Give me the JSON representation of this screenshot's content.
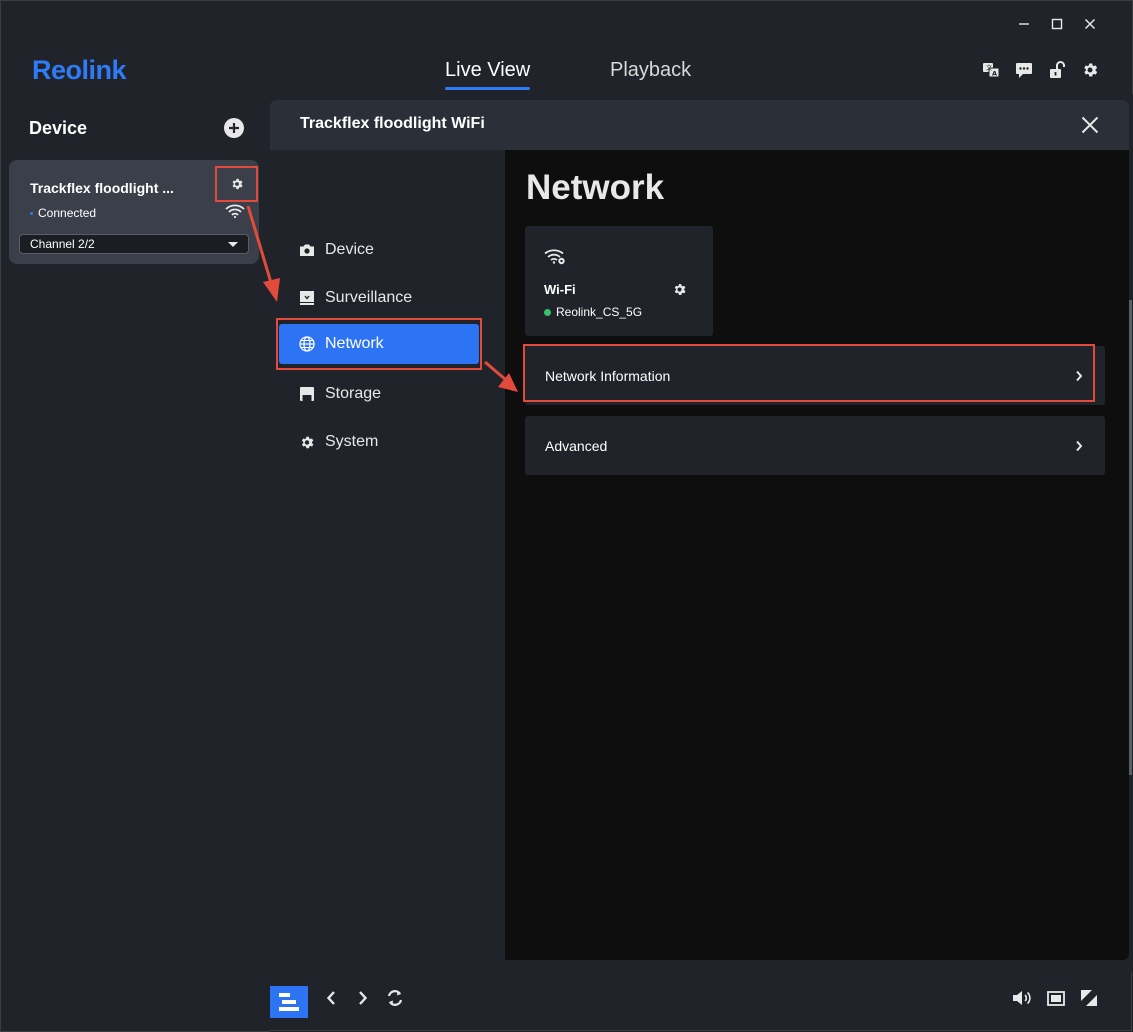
{
  "app": {
    "logo": "Reolink",
    "window_controls": {
      "minimize": "−",
      "maximize": "□",
      "close": "✕"
    },
    "tabs": [
      {
        "label": "Live View",
        "active": true
      },
      {
        "label": "Playback",
        "active": false
      }
    ],
    "toolbar_icons": [
      "translate-icon",
      "chat-icon",
      "unlock-icon",
      "gear-icon"
    ]
  },
  "sidebar": {
    "title": "Device",
    "add_icon": "plus-circle-icon",
    "device": {
      "name": "Trackflex floodlight ...",
      "status": "Connected",
      "channel": "Channel 2/2"
    }
  },
  "modal": {
    "title": "Trackflex floodlight WiFi",
    "menu": [
      {
        "label": "Device",
        "icon": "camera-icon"
      },
      {
        "label": "Surveillance",
        "icon": "monitor-icon"
      },
      {
        "label": "Network",
        "icon": "globe-icon",
        "active": true
      },
      {
        "label": "Storage",
        "icon": "floppy-icon"
      },
      {
        "label": "System",
        "icon": "gear-icon"
      }
    ],
    "content": {
      "title": "Network",
      "wifi_card": {
        "label": "Wi-Fi",
        "network": "Reolink_CS_5G"
      },
      "rows": [
        {
          "label": "Network Information"
        },
        {
          "label": "Advanced"
        }
      ]
    }
  },
  "colors": {
    "accent": "#2d74f5",
    "highlight": "#e24b3b",
    "connected": "#35c46a"
  }
}
